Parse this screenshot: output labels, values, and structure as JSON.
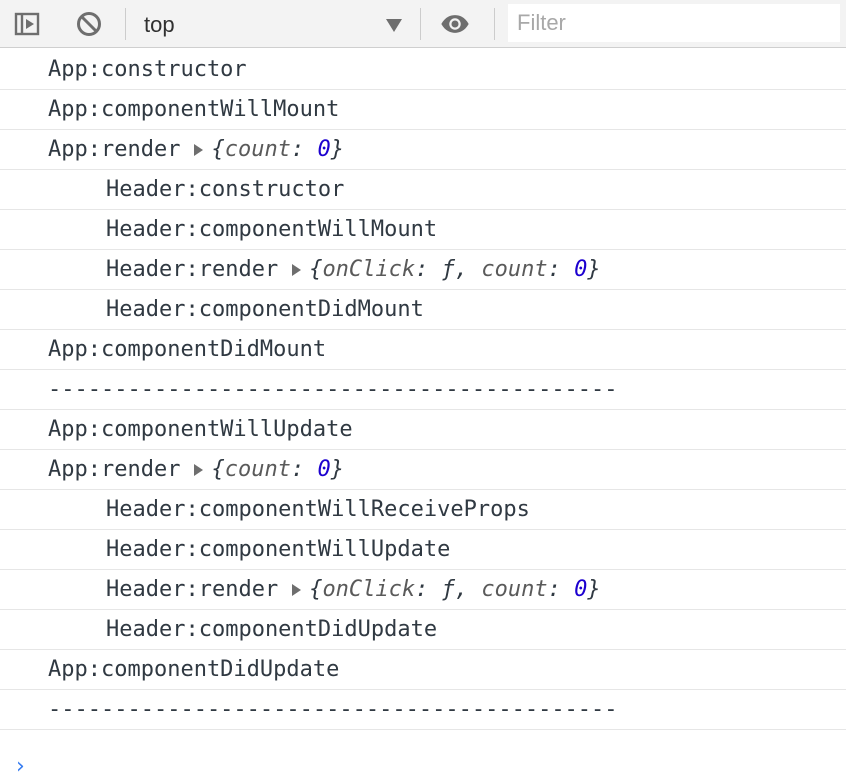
{
  "toolbar": {
    "context": "top",
    "filter_placeholder": "Filter",
    "icons": [
      "sidebar-toggle-icon",
      "clear-console-icon",
      "dropdown-arrow-icon",
      "eye-icon"
    ]
  },
  "colors": {
    "number": "#1c00cf",
    "prompt": "#367cf1"
  },
  "console": {
    "lines": [
      {
        "level": 0,
        "text": "App:constructor"
      },
      {
        "level": 0,
        "text": "App:componentWillMount"
      },
      {
        "level": 0,
        "text": "App:render",
        "object": [
          {
            "key": "count",
            "sep": ": ",
            "value": "0",
            "kind": "num"
          }
        ]
      },
      {
        "level": 1,
        "text": "Header:constructor"
      },
      {
        "level": 1,
        "text": "Header:componentWillMount"
      },
      {
        "level": 1,
        "text": "Header:render",
        "object": [
          {
            "key": "onClick",
            "sep": ": ",
            "value": "ƒ",
            "kind": "fn"
          },
          {
            "key": "count",
            "sep": ": ",
            "value": "0",
            "kind": "num"
          }
        ]
      },
      {
        "level": 1,
        "text": "Header:componentDidMount"
      },
      {
        "level": 0,
        "text": "App:componentDidMount"
      },
      {
        "level": 0,
        "text": "-------------------------------------------"
      },
      {
        "level": 0,
        "text": "App:componentWillUpdate"
      },
      {
        "level": 0,
        "text": "App:render",
        "object": [
          {
            "key": "count",
            "sep": ": ",
            "value": "0",
            "kind": "num"
          }
        ]
      },
      {
        "level": 1,
        "text": "Header:componentWillReceiveProps"
      },
      {
        "level": 1,
        "text": "Header:componentWillUpdate"
      },
      {
        "level": 1,
        "text": "Header:render",
        "object": [
          {
            "key": "onClick",
            "sep": ": ",
            "value": "ƒ",
            "kind": "fn"
          },
          {
            "key": "count",
            "sep": ": ",
            "value": "0",
            "kind": "num"
          }
        ]
      },
      {
        "level": 1,
        "text": "Header:componentDidUpdate"
      },
      {
        "level": 0,
        "text": "App:componentDidUpdate"
      },
      {
        "level": 0,
        "text": "-------------------------------------------"
      }
    ],
    "prompt": "›"
  }
}
